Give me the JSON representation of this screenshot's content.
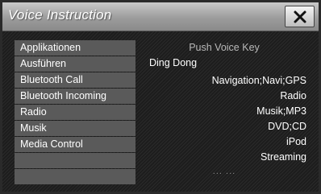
{
  "window": {
    "title": "Voice Instruction",
    "close_icon": "close-icon"
  },
  "sidebar": {
    "items": [
      {
        "label": "Applikationen"
      },
      {
        "label": "Ausführen"
      },
      {
        "label": "Bluetooth Call"
      },
      {
        "label": "Bluetooth Incoming"
      },
      {
        "label": "Radio"
      },
      {
        "label": "Musik"
      },
      {
        "label": "Media Control"
      },
      {
        "label": ""
      },
      {
        "label": ""
      }
    ]
  },
  "panel": {
    "header": "Push Voice Key",
    "sub_label": "Ding Dong",
    "commands": [
      "Navigation;Navi;GPS",
      "Radio",
      "Musik;MP3",
      "DVD;CD",
      "iPod",
      "Streaming"
    ],
    "more_indicator": "... ..."
  },
  "colors": {
    "titlebar": "#a8a8a8",
    "content_bg": "#1d1d1d",
    "list_item_bg": "#5a5a5a",
    "text": "#ffffff"
  }
}
